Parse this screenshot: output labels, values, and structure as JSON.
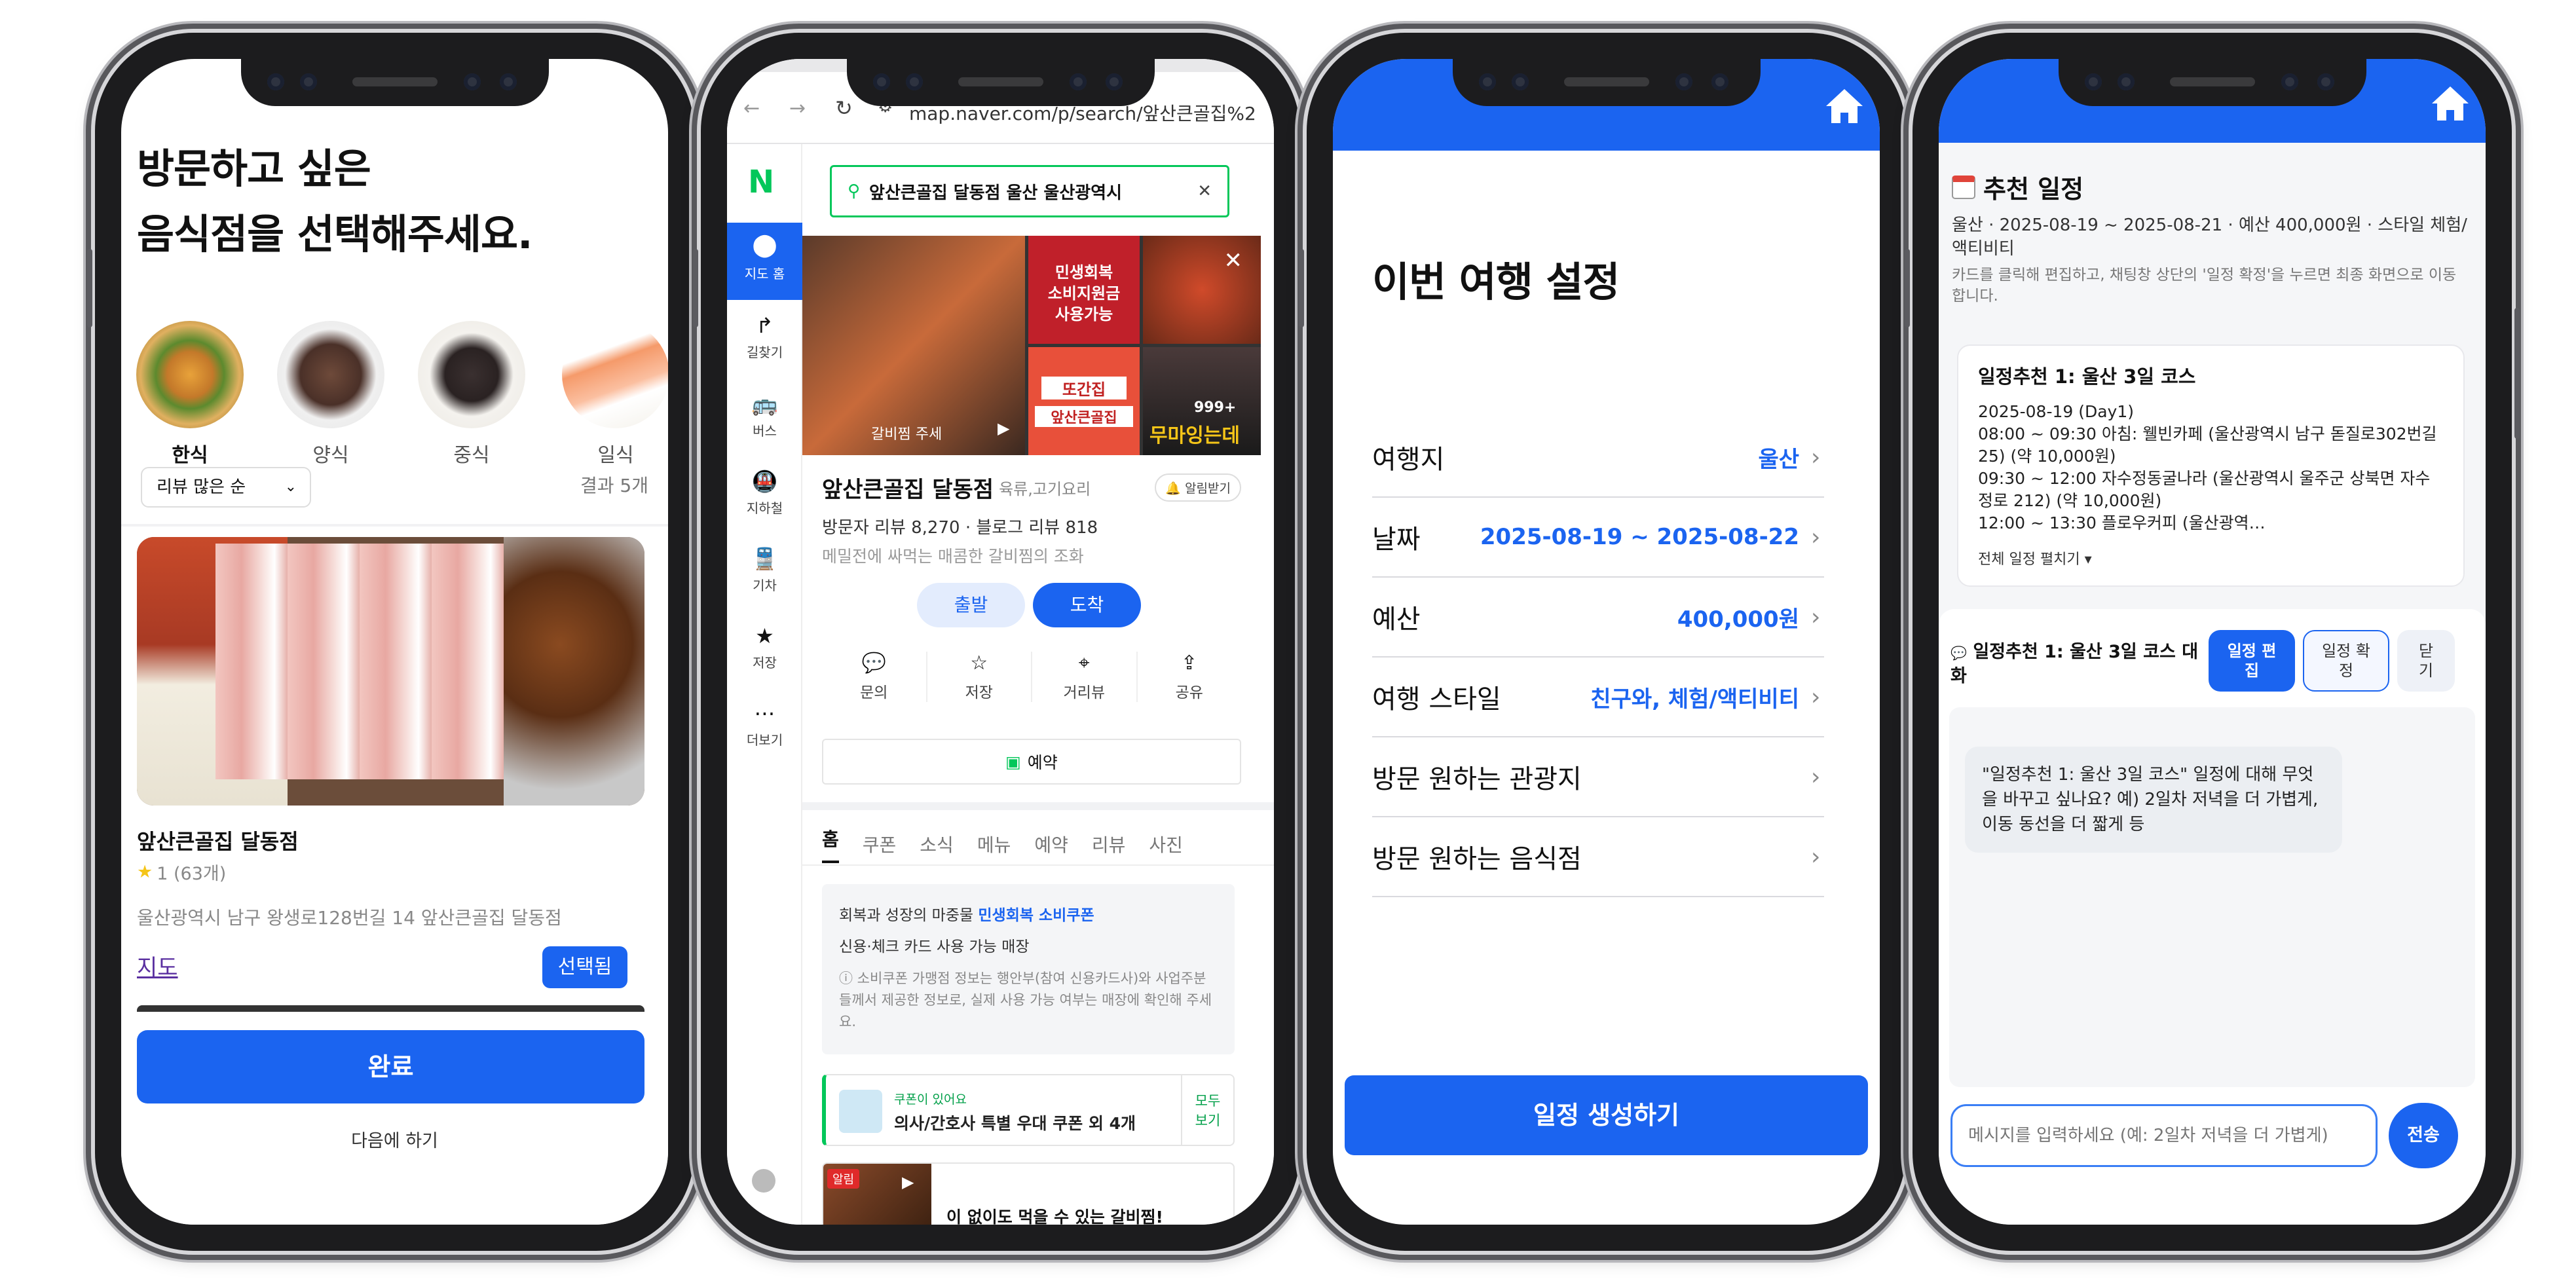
{
  "phone1": {
    "title_line1": "방문하고 싶은",
    "title_line2": "음식점을 선택해주세요.",
    "categories": [
      {
        "label": "한식",
        "icon": "bibimbap-icon"
      },
      {
        "label": "양식",
        "icon": "steak-icon"
      },
      {
        "label": "중식",
        "icon": "noodle-icon"
      },
      {
        "label": "일식",
        "icon": "sushi-icon"
      }
    ],
    "sort_label": "리뷰 많은 순",
    "result_count": "결과 5개",
    "restaurant": {
      "name": "앞산큰골집 달동점",
      "rating": "1 (63개)",
      "address": "울산광역시 남구 왕생로128번길 14 앞산큰골집 달동점",
      "map_link": "지도",
      "select_label": "선택됨"
    },
    "done_label": "완료",
    "later_label": "다음에 하기"
  },
  "phone2": {
    "url": "map.naver.com/p/search/앞산큰골집%2",
    "logo": "N",
    "search_query": "앞산큰골집 달동점 울산 울산광역시",
    "sidebar": [
      {
        "label": "지도 홈",
        "icon": "pin-icon"
      },
      {
        "label": "길찾기",
        "icon": "directions-icon"
      },
      {
        "label": "버스",
        "icon": "bus-icon"
      },
      {
        "label": "지하철",
        "icon": "subway-icon"
      },
      {
        "label": "기차",
        "icon": "train-icon"
      },
      {
        "label": "저장",
        "icon": "star-icon"
      },
      {
        "label": "더보기",
        "icon": "more-icon"
      }
    ],
    "photo_caption": "갈비찜 주세",
    "promo_line1": "민생회복",
    "promo_line2": "소비지원금",
    "promo_line3": "사용가능",
    "sign_text1": "또간집",
    "sign_text2": "앞산큰골집",
    "photo_count": "999+",
    "photo_overlay": "무마잉는데",
    "place_name": "앞산큰골집 달동점",
    "place_category": "육류,고기요리",
    "alarm_label": "알림받기",
    "review_stats": "방문자 리뷰 8,270 · 블로그 리뷰 818",
    "tagline": "메밀전에 싸먹는 매콤한 갈비찜의 조화",
    "depart_label": "출발",
    "arrive_label": "도착",
    "actions": [
      {
        "label": "문의",
        "icon": "chat-icon"
      },
      {
        "label": "저장",
        "icon": "star-icon"
      },
      {
        "label": "거리뷰",
        "icon": "location-icon"
      },
      {
        "label": "공유",
        "icon": "share-icon"
      }
    ],
    "reserve_label": "예약",
    "tabs": [
      "홈",
      "쿠폰",
      "소식",
      "메뉴",
      "예약",
      "리뷰",
      "사진"
    ],
    "coupon_line1_prefix": "회복과 성장의 마중물",
    "coupon_line1_highlight": "민생회복 소비쿠폰",
    "coupon_line2": "신용·체크 카드 사용 가능 매장",
    "coupon_note": "ⓘ 소비쿠폰 가맹점 정보는 행안부(참여 신용카드사)와 사업주분들께서 제공한 정보로, 실제 사용 가능 여부는 매장에 확인해 주세요.",
    "coupon_tag": "쿠폰이 있어요",
    "coupon_text": "의사/간호사 특별 우대 쿠폰 외 4개",
    "coupon_all": "모두 보기",
    "clip_badge": "알림",
    "clip_text": "이 없이도 먹을 수 있는 갈비찜!"
  },
  "phone3": {
    "title": "이번 여행 설정",
    "rows": [
      {
        "label": "여행지",
        "value": "울산"
      },
      {
        "label": "날짜",
        "value": "2025-08-19 ~ 2025-08-22"
      },
      {
        "label": "예산",
        "value": "400,000원"
      },
      {
        "label": "여행 스타일",
        "value": "친구와, 체험/액티비티"
      },
      {
        "label": "방문 원하는 관광지",
        "value": ""
      },
      {
        "label": "방문 원하는 음식점",
        "value": ""
      }
    ],
    "generate_label": "일정 생성하기"
  },
  "phone4": {
    "title": "추천 일정",
    "summary": "울산 · 2025-08-19 ~ 2025-08-21 · 예산 400,000원 · 스타일 체험/액티비티",
    "hint": "카드를 클릭해 편집하고, 채팅창 상단의 '일정 확정'을 누르면 최종 화면으로 이동합니다.",
    "card_title": "일정추천 1: 울산 3일 코스",
    "card_lines": [
      "2025-08-19 (Day1)",
      "08:00 ~ 09:30 아침: 웰빈카페 (울산광역시 남구 돋질로302번길 25) (약 10,000원)",
      "09:30 ~ 12:00 자수정동굴나라 (울산광역시 울주군 상북면 자수정로 212) (약 10,000원)",
      "12:00 ~ 13:30 플로우커피 (울산광역…"
    ],
    "expand_label": "전체 일정 펼치기 ▾",
    "chat_title": "일정추천 1: 울산 3일 코스 대화",
    "edit_label": "일정 편집",
    "confirm_label": "일정 확정",
    "close_label": "닫기",
    "bot_message": "\"일정추천 1: 울산 3일 코스\" 일정에 대해 무엇을 바꾸고 싶나요? 예) 2일차 저녁을 더 가볍게, 이동 동선을 더 짧게 등",
    "input_placeholder": "메시지를 입력하세요 (예: 2일차 저녁을 더 가볍게)",
    "send_label": "전송"
  },
  "colors": {
    "primary": "#1b64f0",
    "naver_green": "#03c75a"
  }
}
